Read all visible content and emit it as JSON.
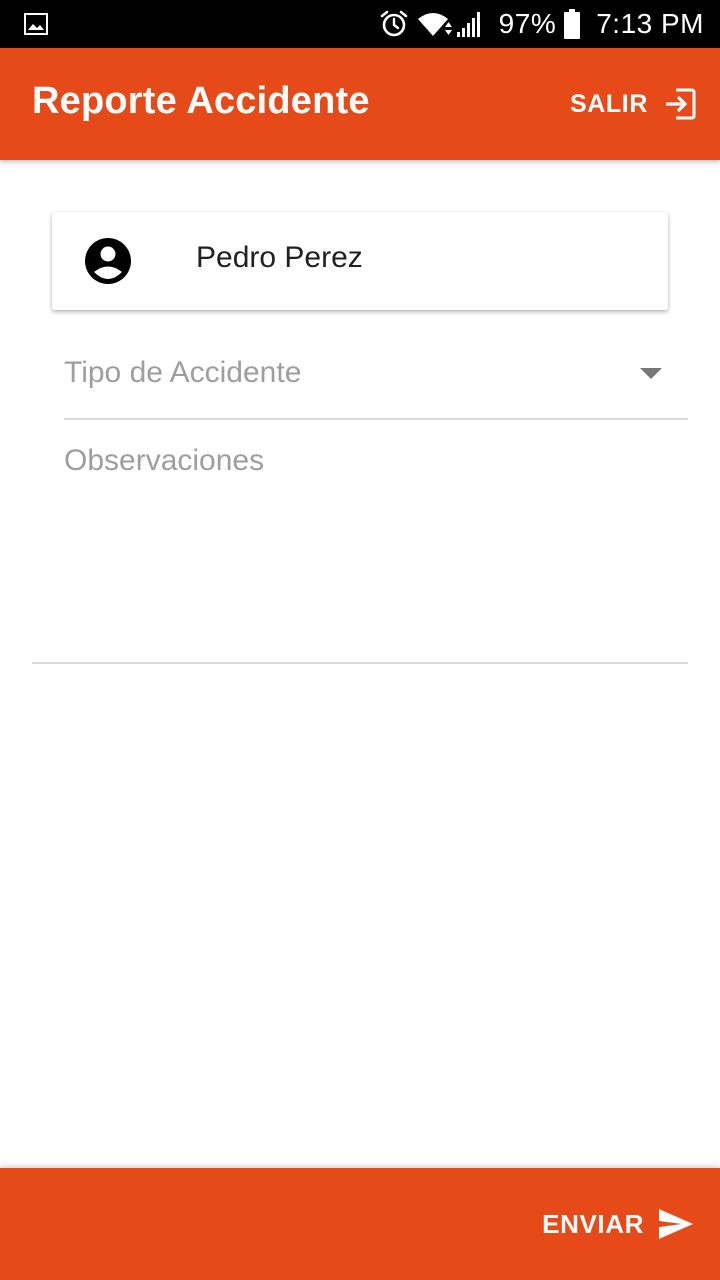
{
  "status_bar": {
    "battery_percent": "97%",
    "time": "7:13 PM",
    "icons": [
      "gallery-icon",
      "alarm-icon",
      "wifi-icon",
      "signal-icon",
      "battery-icon"
    ]
  },
  "app_bar": {
    "title": "Reporte Accidente",
    "exit_label": "SALIR",
    "exit_icon": "exit-to-app-icon",
    "color": "#e64a19"
  },
  "user_card": {
    "name": "Pedro Perez",
    "icon": "account-circle-icon"
  },
  "form": {
    "accident_type": {
      "placeholder": "Tipo de Accidente",
      "icon": "dropdown-arrow-icon"
    },
    "observations": {
      "placeholder": "Observaciones",
      "value": ""
    }
  },
  "bottom_bar": {
    "send_label": "ENVIAR",
    "send_icon": "send-icon",
    "color": "#e64a19"
  },
  "colors": {
    "accent": "#e64a19",
    "placeholder_text": "#9e9e9e",
    "divider": "#dcdcdc"
  }
}
